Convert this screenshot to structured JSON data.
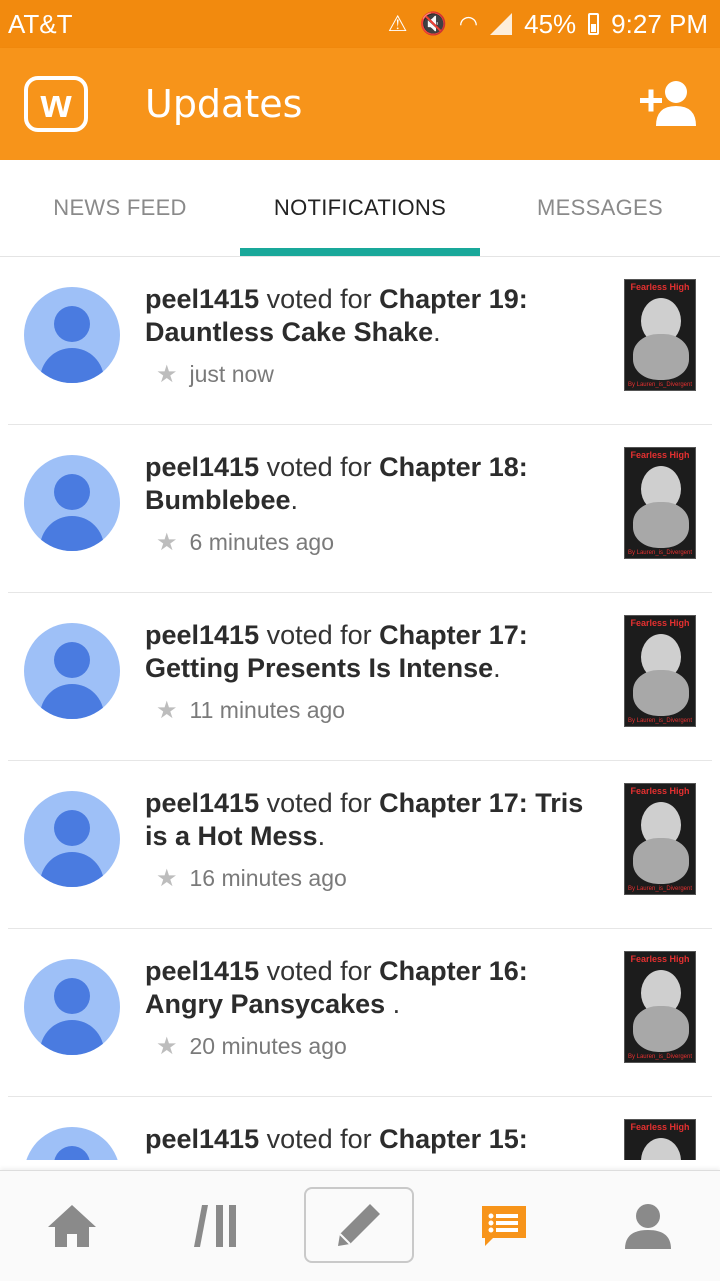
{
  "status_bar": {
    "carrier": "AT&T",
    "battery": "45%",
    "time": "9:27 PM"
  },
  "app_bar": {
    "logo_letter": "w",
    "title": "Updates"
  },
  "tabs": [
    {
      "label": "NEWS FEED",
      "active": false
    },
    {
      "label": "NOTIFICATIONS",
      "active": true
    },
    {
      "label": "MESSAGES",
      "active": false
    }
  ],
  "notifications": [
    {
      "user": "peel1415",
      "action": " voted for ",
      "chapter": "Chapter 19: Dauntless Cake Shake",
      "suffix": ".",
      "time": "just now"
    },
    {
      "user": "peel1415",
      "action": " voted for ",
      "chapter": "Chapter 18: Bumblebee",
      "suffix": ".",
      "time": "6 minutes ago"
    },
    {
      "user": "peel1415",
      "action": " voted for ",
      "chapter": "Chapter 17: Getting Presents Is Intense",
      "suffix": ".",
      "time": "11 minutes ago"
    },
    {
      "user": "peel1415",
      "action": " voted for ",
      "chapter": "Chapter 17: Tris is a Hot Mess",
      "suffix": ".",
      "time": "16 minutes ago"
    },
    {
      "user": "peel1415",
      "action": " voted for ",
      "chapter": "Chapter 16: Angry Pansycakes ",
      "suffix": ".",
      "time": "20 minutes ago"
    },
    {
      "user": "peel1415",
      "action": " voted for ",
      "chapter": "Chapter 15:",
      "suffix": "",
      "time": ""
    }
  ],
  "cover": {
    "title": "Fearless High",
    "author": "By Lauren_is_Divergent"
  },
  "colors": {
    "status_bar": "#f28a0e",
    "app_bar": "#f7941a",
    "tab_indicator": "#19a89a",
    "avatar_bg": "#9ec0f7",
    "avatar_fg": "#4a7be0",
    "active_nav": "#f7941a"
  },
  "bottom_nav": [
    {
      "icon": "home-icon",
      "active": false
    },
    {
      "icon": "library-icon",
      "active": false
    },
    {
      "icon": "pencil-icon",
      "active": false
    },
    {
      "icon": "messages-icon",
      "active": true
    },
    {
      "icon": "profile-icon",
      "active": false
    }
  ]
}
